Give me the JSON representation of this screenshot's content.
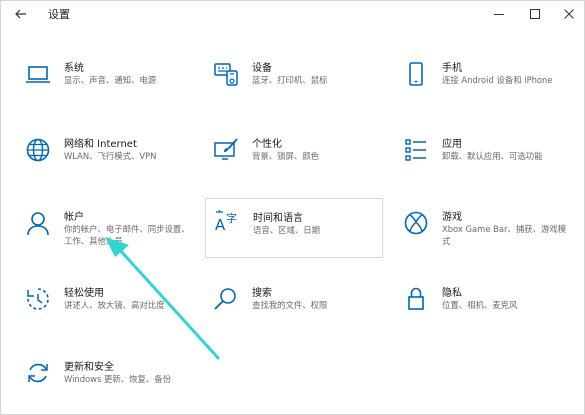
{
  "window": {
    "title": "设置",
    "back_icon": "arrow-left-icon",
    "minimize_icon": "minimize-icon",
    "maximize_icon": "maximize-icon",
    "close_icon": "close-icon"
  },
  "accent_color": "#0067b8",
  "pointer_color": "#2fd6cf",
  "tiles": [
    {
      "title": "系统",
      "desc": "显示、声音、通知、电源",
      "icon": "laptop-icon"
    },
    {
      "title": "设备",
      "desc": "蓝牙、打印机、鼠标",
      "icon": "keyboard-device-icon"
    },
    {
      "title": "手机",
      "desc": "连接 Android 设备和 iPhone",
      "icon": "phone-icon"
    },
    {
      "title": "网络和 Internet",
      "desc": "WLAN、飞行模式、VPN",
      "icon": "globe-icon"
    },
    {
      "title": "个性化",
      "desc": "背景、锁屏、颜色",
      "icon": "brush-icon"
    },
    {
      "title": "应用",
      "desc": "卸载、默认应用、可选功能",
      "icon": "apps-list-icon"
    },
    {
      "title": "帐户",
      "desc": "你的帐户、电子邮件、同步设置、工作、其他人员",
      "icon": "person-icon"
    },
    {
      "title": "时间和语言",
      "desc": "语音、区域、日期",
      "icon": "time-language-icon"
    },
    {
      "title": "游戏",
      "desc": "Xbox Game Bar、捕获、游戏模式",
      "icon": "xbox-icon"
    },
    {
      "title": "轻松使用",
      "desc": "讲述人、放大镜、高对比度",
      "icon": "ease-of-access-icon"
    },
    {
      "title": "搜索",
      "desc": "查找我的文件、权限",
      "icon": "search-icon"
    },
    {
      "title": "隐私",
      "desc": "位置、相机、麦克风",
      "icon": "lock-icon"
    },
    {
      "title": "更新和安全",
      "desc": "Windows 更新、恢复、备份",
      "icon": "refresh-icon"
    }
  ]
}
